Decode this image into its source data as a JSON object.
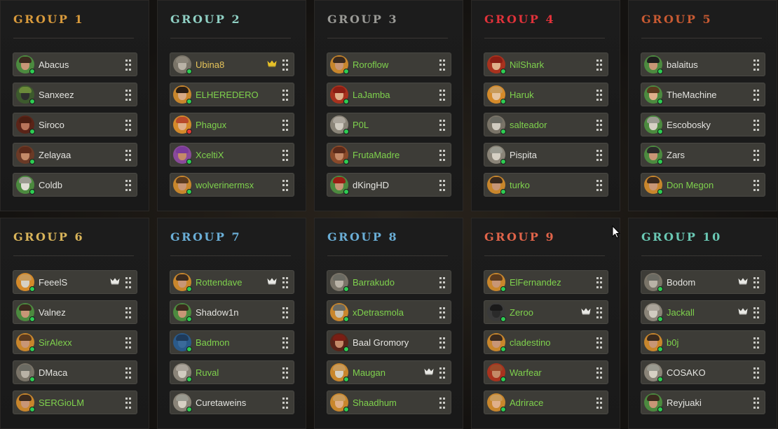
{
  "groups": [
    {
      "title": "GROUP 1",
      "color": "#d89a3c",
      "players": [
        {
          "name": "Abacus",
          "status": "online",
          "name_color": "w",
          "crown": false,
          "avatar": {
            "skin": "#c89676",
            "hair": "#3a2a1e",
            "bg": "#4c8a3f"
          }
        },
        {
          "name": "Sanxeez",
          "status": "online",
          "name_color": "w",
          "crown": false,
          "avatar": {
            "skin": "#2e2e2e",
            "hair": "#6b8a3a",
            "bg": "#3d5a2d"
          }
        },
        {
          "name": "Siroco",
          "status": "online",
          "name_color": "w",
          "crown": false,
          "avatar": {
            "skin": "#b8745a",
            "hair": "#4a1e12",
            "bg": "#5a2418"
          }
        },
        {
          "name": "Zelayaa",
          "status": "online",
          "name_color": "w",
          "crown": false,
          "avatar": {
            "skin": "#c48a68",
            "hair": "#5a2a1a",
            "bg": "#6a3a26"
          }
        },
        {
          "name": "Coldb",
          "status": "online",
          "name_color": "w",
          "crown": false,
          "avatar": {
            "skin": "#e0ddd5",
            "hair": "#9a9a90",
            "bg": "#4c8a3f"
          }
        }
      ]
    },
    {
      "title": "GROUP 2",
      "color": "#8fd0c4",
      "players": [
        {
          "name": "Ubina8",
          "status": "online",
          "name_color": "y",
          "crown": true,
          "avatar": {
            "skin": "#b9b2a6",
            "hair": "#8a8478",
            "bg": "#7a7468"
          }
        },
        {
          "name": "ELHEREDERO",
          "status": "online",
          "name_color": "g",
          "crown": false,
          "avatar": {
            "skin": "#d6a985",
            "hair": "#2a1e14",
            "bg": "#c8862c"
          }
        },
        {
          "name": "Phagux",
          "status": "offline",
          "name_color": "g",
          "crown": false,
          "avatar": {
            "skin": "#e0b08a",
            "hair": "#b84a2a",
            "bg": "#d48a2a"
          }
        },
        {
          "name": "XceltiX",
          "status": "online",
          "name_color": "g",
          "crown": false,
          "avatar": {
            "skin": "#c48a68",
            "hair": "#7a3a9a",
            "bg": "#8a4a9a"
          }
        },
        {
          "name": "wolverinermsx",
          "status": "online",
          "name_color": "g",
          "crown": false,
          "avatar": {
            "skin": "#c89676",
            "hair": "#5a3a1e",
            "bg": "#c8862c"
          }
        }
      ]
    },
    {
      "title": "GROUP 3",
      "color": "#9a9a96",
      "players": [
        {
          "name": "Roroflow",
          "status": "online",
          "name_color": "g",
          "crown": false,
          "avatar": {
            "skin": "#c89676",
            "hair": "#3a2a1e",
            "bg": "#c8862c"
          }
        },
        {
          "name": "LaJamba",
          "status": "online",
          "name_color": "g",
          "crown": false,
          "avatar": {
            "skin": "#e0b08a",
            "hair": "#8a1e14",
            "bg": "#a8321e"
          }
        },
        {
          "name": "P0L",
          "status": "online",
          "name_color": "g",
          "crown": false,
          "avatar": {
            "skin": "#d0cbc0",
            "hair": "#aaa49a",
            "bg": "#8a8478"
          }
        },
        {
          "name": "FrutaMadre",
          "status": "online",
          "name_color": "g",
          "crown": false,
          "avatar": {
            "skin": "#c48a68",
            "hair": "#5a2a1a",
            "bg": "#8a4a2a"
          }
        },
        {
          "name": "dKingHD",
          "status": "online",
          "name_color": "w",
          "crown": false,
          "avatar": {
            "skin": "#c89676",
            "hair": "#9a1e14",
            "bg": "#4c8a3f"
          }
        }
      ]
    },
    {
      "title": "GROUP 4",
      "color": "#e0323a",
      "players": [
        {
          "name": "NilShark",
          "status": "online",
          "name_color": "g",
          "crown": false,
          "avatar": {
            "skin": "#e0b08a",
            "hair": "#8a1e14",
            "bg": "#a8321e"
          }
        },
        {
          "name": "Haruk",
          "status": "online",
          "name_color": "g",
          "crown": false,
          "avatar": {
            "skin": "#e6c4a0",
            "hair": "#c89a5a",
            "bg": "#d48a2a"
          }
        },
        {
          "name": "salteador",
          "status": "online",
          "name_color": "g",
          "crown": false,
          "avatar": {
            "skin": "#d0cbc0",
            "hair": "#6a6a62",
            "bg": "#7a7468"
          }
        },
        {
          "name": "Pispita",
          "status": "online",
          "name_color": "w",
          "crown": false,
          "avatar": {
            "skin": "#d6d0c4",
            "hair": "#9a9a90",
            "bg": "#8a8478"
          }
        },
        {
          "name": "turko",
          "status": "online",
          "name_color": "g",
          "crown": false,
          "avatar": {
            "skin": "#c89676",
            "hair": "#3a2a1e",
            "bg": "#c8862c"
          }
        }
      ]
    },
    {
      "title": "GROUP 5",
      "color": "#c85a32",
      "players": [
        {
          "name": "balaitus",
          "status": "online",
          "name_color": "w",
          "crown": false,
          "avatar": {
            "skin": "#c89676",
            "hair": "#1e1e1e",
            "bg": "#4c8a3f"
          }
        },
        {
          "name": "TheMachine",
          "status": "online",
          "name_color": "w",
          "crown": false,
          "avatar": {
            "skin": "#e0b08a",
            "hair": "#5a3a1e",
            "bg": "#4c8a3f"
          }
        },
        {
          "name": "Escobosky",
          "status": "online",
          "name_color": "w",
          "crown": false,
          "avatar": {
            "skin": "#d6d0c4",
            "hair": "#9a9a90",
            "bg": "#4c8a3f"
          }
        },
        {
          "name": "Zars",
          "status": "online",
          "name_color": "w",
          "crown": false,
          "avatar": {
            "skin": "#c89676",
            "hair": "#2a2a2a",
            "bg": "#4c8a3f"
          }
        },
        {
          "name": "Don Megon",
          "status": "online",
          "name_color": "g",
          "crown": false,
          "avatar": {
            "skin": "#c89676",
            "hair": "#3a2a1e",
            "bg": "#c8862c"
          }
        }
      ]
    },
    {
      "title": "GROUP 6",
      "color": "#d8b45a",
      "players": [
        {
          "name": "FeeelS",
          "status": "online",
          "name_color": "w",
          "crown": true,
          "avatar": {
            "skin": "#d6d0c4",
            "hair": "#c89a5a",
            "bg": "#d48a2a"
          }
        },
        {
          "name": "Valnez",
          "status": "online",
          "name_color": "w",
          "crown": false,
          "avatar": {
            "skin": "#c89676",
            "hair": "#3a2a1e",
            "bg": "#4c8a3f"
          }
        },
        {
          "name": "SirAlexx",
          "status": "online",
          "name_color": "g",
          "crown": false,
          "avatar": {
            "skin": "#c89676",
            "hair": "#5a3a1e",
            "bg": "#c8862c"
          }
        },
        {
          "name": "DMaca",
          "status": "online",
          "name_color": "w",
          "crown": false,
          "avatar": {
            "skin": "#b9b2a6",
            "hair": "#6a6a62",
            "bg": "#7a7468"
          }
        },
        {
          "name": "SERGioLM",
          "status": "online",
          "name_color": "g",
          "crown": false,
          "avatar": {
            "skin": "#c89676",
            "hair": "#3a2a1e",
            "bg": "#c8862c"
          }
        }
      ]
    },
    {
      "title": "GROUP 7",
      "color": "#6aaed6",
      "players": [
        {
          "name": "Rottendave",
          "status": "online",
          "name_color": "g",
          "crown": true,
          "avatar": {
            "skin": "#c89676",
            "hair": "#3a2a1e",
            "bg": "#c8862c"
          }
        },
        {
          "name": "Shadow1n",
          "status": "online",
          "name_color": "w",
          "crown": false,
          "avatar": {
            "skin": "#c89676",
            "hair": "#3a2a1e",
            "bg": "#4c8a3f"
          }
        },
        {
          "name": "Badmon",
          "status": "online",
          "name_color": "g",
          "crown": false,
          "avatar": {
            "skin": "#3a6a9a",
            "hair": "#1e3a5a",
            "bg": "#2a5a8a"
          }
        },
        {
          "name": "Ruval",
          "status": "online",
          "name_color": "g",
          "crown": false,
          "avatar": {
            "skin": "#d0cbc0",
            "hair": "#aaa49a",
            "bg": "#8a8478"
          }
        },
        {
          "name": "Curetaweins",
          "status": "online",
          "name_color": "w",
          "crown": false,
          "avatar": {
            "skin": "#d6d0c4",
            "hair": "#9a9a90",
            "bg": "#8a8478"
          }
        }
      ]
    },
    {
      "title": "GROUP 8",
      "color": "#6aaed6",
      "players": [
        {
          "name": "Barrakudo",
          "status": "online",
          "name_color": "g",
          "crown": false,
          "avatar": {
            "skin": "#b9b2a6",
            "hair": "#6a6a62",
            "bg": "#7a7468"
          }
        },
        {
          "name": "xDetrasmola",
          "status": "online",
          "name_color": "g",
          "crown": false,
          "avatar": {
            "skin": "#c8c2b4",
            "hair": "#6a6a62",
            "bg": "#c8862c"
          }
        },
        {
          "name": "Baal Gromory",
          "status": "online",
          "name_color": "w",
          "crown": false,
          "avatar": {
            "skin": "#c48a68",
            "hair": "#7a1e14",
            "bg": "#5a2418"
          }
        },
        {
          "name": "Maugan",
          "status": "online",
          "name_color": "g",
          "crown": true,
          "avatar": {
            "skin": "#d6d0c4",
            "hair": "#c89a5a",
            "bg": "#c8862c"
          }
        },
        {
          "name": "Shaadhum",
          "status": "online",
          "name_color": "g",
          "crown": false,
          "avatar": {
            "skin": "#e0b08a",
            "hair": "#c89a5a",
            "bg": "#c8862c"
          }
        }
      ]
    },
    {
      "title": "GROUP 9",
      "color": "#e0644a",
      "players": [
        {
          "name": "ElFernandez",
          "status": "online",
          "name_color": "g",
          "crown": false,
          "avatar": {
            "skin": "#c89676",
            "hair": "#5a3a1e",
            "bg": "#c8862c"
          }
        },
        {
          "name": "Zeroo",
          "status": "online",
          "name_color": "g",
          "crown": true,
          "avatar": {
            "skin": "#2a2a2a",
            "hair": "#1a1a1a",
            "bg": "#3a3a3a"
          }
        },
        {
          "name": "cladestino",
          "status": "online",
          "name_color": "g",
          "crown": false,
          "avatar": {
            "skin": "#c89676",
            "hair": "#3a2a1e",
            "bg": "#c8862c"
          }
        },
        {
          "name": "Warfear",
          "status": "online",
          "name_color": "g",
          "crown": false,
          "avatar": {
            "skin": "#c48a68",
            "hair": "#9a4a2a",
            "bg": "#a8321e"
          }
        },
        {
          "name": "Adrirace",
          "status": "online",
          "name_color": "g",
          "crown": false,
          "avatar": {
            "skin": "#e0b08a",
            "hair": "#c89a5a",
            "bg": "#c8862c"
          }
        }
      ]
    },
    {
      "title": "GROUP 10",
      "color": "#6ac8b4",
      "players": [
        {
          "name": "Bodom",
          "status": "online",
          "name_color": "w",
          "crown": true,
          "avatar": {
            "skin": "#b9b2a6",
            "hair": "#6a6a62",
            "bg": "#7a7468"
          }
        },
        {
          "name": "Jackall",
          "status": "online",
          "name_color": "g",
          "crown": true,
          "avatar": {
            "skin": "#d0cbc0",
            "hair": "#aaa49a",
            "bg": "#8a8478"
          }
        },
        {
          "name": "b0j",
          "status": "online",
          "name_color": "g",
          "crown": false,
          "avatar": {
            "skin": "#c89676",
            "hair": "#3a2a1e",
            "bg": "#c8862c"
          }
        },
        {
          "name": "COSAKO",
          "status": "online",
          "name_color": "w",
          "crown": false,
          "avatar": {
            "skin": "#d6d0c4",
            "hair": "#9a9a90",
            "bg": "#8a8478"
          }
        },
        {
          "name": "Reyjuaki",
          "status": "online",
          "name_color": "w",
          "crown": false,
          "avatar": {
            "skin": "#c89676",
            "hair": "#3a2a1e",
            "bg": "#4c8a3f"
          }
        }
      ]
    }
  ],
  "colors": {
    "crown_gold": "#e6c028",
    "crown_white": "#e8e8e4",
    "online": "#2ecc52",
    "offline": "#e53935"
  }
}
